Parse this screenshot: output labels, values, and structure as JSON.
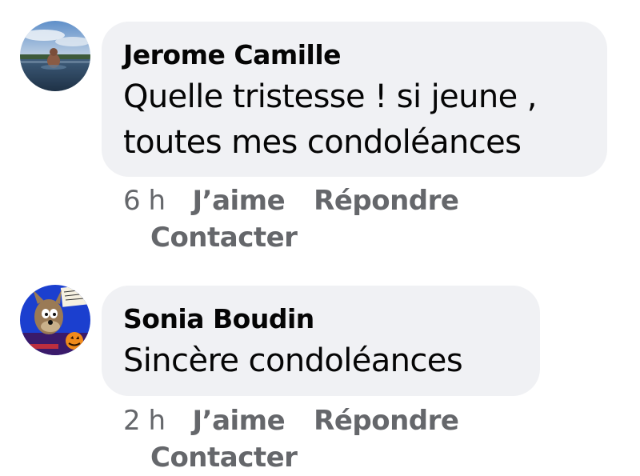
{
  "comments": [
    {
      "author": "Jerome Camille",
      "text_lines": [
        "Quelle tristesse ! si jeune ,",
        "toutes mes condoléances"
      ],
      "time": "6 h",
      "like_label": "J’aime",
      "reply_label": "Répondre",
      "contact_label": "Contacter"
    },
    {
      "author": "Sonia Boudin",
      "text_lines": [
        "Sincère condoléances"
      ],
      "time": "2 h",
      "like_label": "J’aime",
      "reply_label": "Répondre",
      "contact_label": "Contacter"
    }
  ],
  "colors": {
    "bubble": "#f0f1f4",
    "text": "#050505",
    "meta": "#65676b"
  }
}
